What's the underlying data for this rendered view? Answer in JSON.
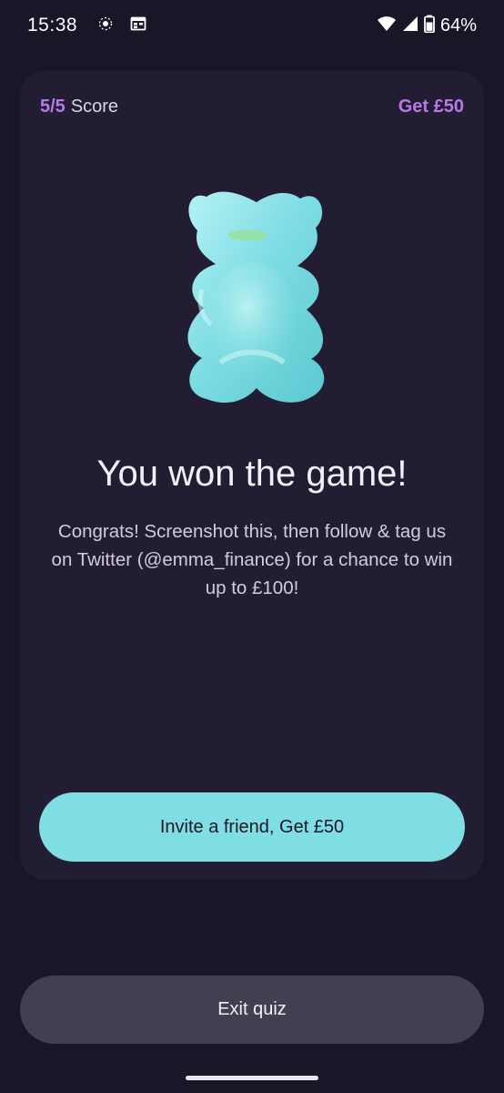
{
  "status_bar": {
    "time": "15:38",
    "battery_percent": "64%",
    "icons": [
      "notification-icon",
      "calendar-icon",
      "wifi-icon",
      "cell-signal-icon",
      "battery-icon"
    ]
  },
  "card": {
    "score_value": "5/5",
    "score_label": "Score",
    "reward_link": "Get £50",
    "headline": "You won the game!",
    "body": "Congrats! Screenshot this, then follow & tag us on Twitter (@emma_finance) for a chance to win up to £100!",
    "invite_button": "Invite a friend, Get £50"
  },
  "footer": {
    "exit_button": "Exit quiz"
  },
  "colors": {
    "background": "#1a1527",
    "card": "#231d33",
    "accent_purple": "#b57ae8",
    "accent_teal": "#7fdde4",
    "exit_button": "#433f50"
  }
}
